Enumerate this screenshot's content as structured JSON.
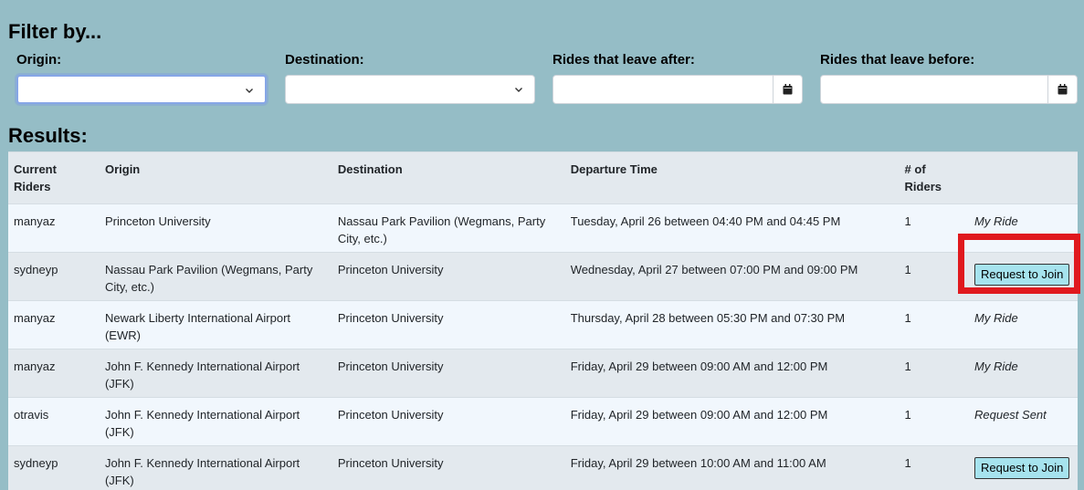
{
  "filters": {
    "heading": "Filter by...",
    "origin_label": "Origin:",
    "origin_value": "",
    "destination_label": "Destination:",
    "destination_value": "",
    "after_label": "Rides that leave after:",
    "after_value": "",
    "before_label": "Rides that leave before:",
    "before_value": ""
  },
  "results": {
    "heading": "Results:",
    "columns": [
      "Current Riders",
      "Origin",
      "Destination",
      "Departure Time",
      "# of Riders",
      ""
    ],
    "rows": [
      {
        "rider": "manyaz",
        "origin": "Princeton University",
        "destination": "Nassau Park Pavilion (Wegmans, Party City, etc.)",
        "time": "Tuesday, April 26 between 04:40 PM and 04:45 PM",
        "count": "1",
        "action": "My Ride",
        "action_type": "status"
      },
      {
        "rider": "sydneyp",
        "origin": "Nassau Park Pavilion (Wegmans, Party City, etc.)",
        "destination": "Princeton University",
        "time": "Wednesday, April 27 between 07:00 PM and 09:00 PM",
        "count": "1",
        "action": "Request to Join",
        "action_type": "button"
      },
      {
        "rider": "manyaz",
        "origin": "Newark Liberty International Airport (EWR)",
        "destination": "Princeton University",
        "time": "Thursday, April 28 between 05:30 PM and 07:30 PM",
        "count": "1",
        "action": "My Ride",
        "action_type": "status"
      },
      {
        "rider": "manyaz",
        "origin": "John F. Kennedy International Airport (JFK)",
        "destination": "Princeton University",
        "time": "Friday, April 29 between 09:00 AM and 12:00 PM",
        "count": "1",
        "action": "My Ride",
        "action_type": "status"
      },
      {
        "rider": "otravis",
        "origin": "John F. Kennedy International Airport (JFK)",
        "destination": "Princeton University",
        "time": "Friday, April 29 between 09:00 AM and 12:00 PM",
        "count": "1",
        "action": "Request Sent",
        "action_type": "status"
      },
      {
        "rider": "sydneyp",
        "origin": "John F. Kennedy International Airport (JFK)",
        "destination": "Princeton University",
        "time": "Friday, April 29 between 10:00 AM and 11:00 AM",
        "count": "1",
        "action": "Request to Join",
        "action_type": "button"
      }
    ]
  },
  "colors": {
    "background": "#95bdc6",
    "row_light": "#f1f7fd",
    "row_dark": "#e3e9ee",
    "button": "#a6e3ee",
    "highlight": "#e0191e"
  },
  "icons": {
    "select_arrow": "chevron-down-icon",
    "date_picker": "calendar-icon"
  }
}
